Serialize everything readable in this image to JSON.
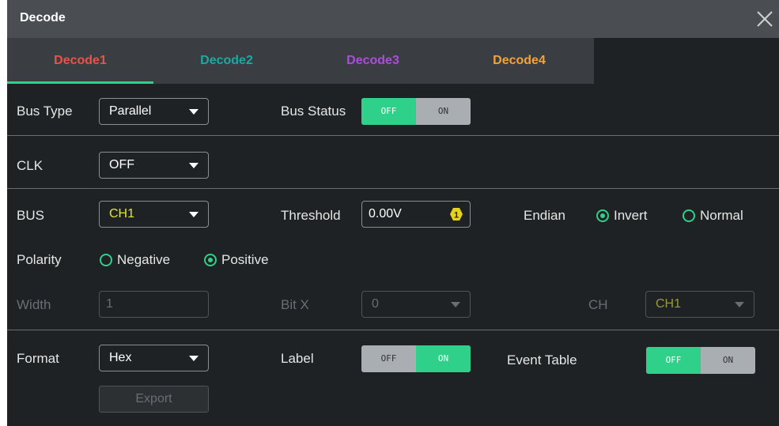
{
  "window": {
    "title": "Decode"
  },
  "tabs": [
    {
      "label": "Decode1",
      "color": "#e8534b",
      "active": true
    },
    {
      "label": "Decode2",
      "color": "#1ba9a4",
      "active": false
    },
    {
      "label": "Decode3",
      "color": "#a94fd6",
      "active": false
    },
    {
      "label": "Decode4",
      "color": "#f0a43a",
      "active": false
    }
  ],
  "bus_type": {
    "label": "Bus Type",
    "value": "Parallel"
  },
  "bus_status": {
    "label": "Bus Status",
    "off": "OFF",
    "on": "ON",
    "state": "off"
  },
  "clk": {
    "label": "CLK",
    "value": "OFF"
  },
  "bus": {
    "label": "BUS",
    "value": "CH1",
    "value_color": "#e6e61a"
  },
  "threshold": {
    "label": "Threshold",
    "value": "0.00V",
    "badge": "1"
  },
  "endian": {
    "label": "Endian",
    "options": [
      "Invert",
      "Normal"
    ],
    "selected": "Invert"
  },
  "polarity": {
    "label": "Polarity",
    "options": [
      "Negative",
      "Positive"
    ],
    "selected": "Positive"
  },
  "width": {
    "label": "Width",
    "value": "1"
  },
  "bitx": {
    "label": "Bit X",
    "value": "0"
  },
  "ch": {
    "label": "CH",
    "value": "CH1"
  },
  "format": {
    "label": "Format",
    "value": "Hex"
  },
  "label_toggle": {
    "label": "Label",
    "off": "OFF",
    "on": "ON",
    "state": "on"
  },
  "event_table": {
    "label": "Event Table",
    "off": "OFF",
    "on": "ON",
    "state": "off"
  },
  "export": {
    "label": "Export"
  },
  "colors": {
    "accent": "#2fd08a",
    "background": "#1f2224",
    "titlebar": "#4a4e52"
  }
}
